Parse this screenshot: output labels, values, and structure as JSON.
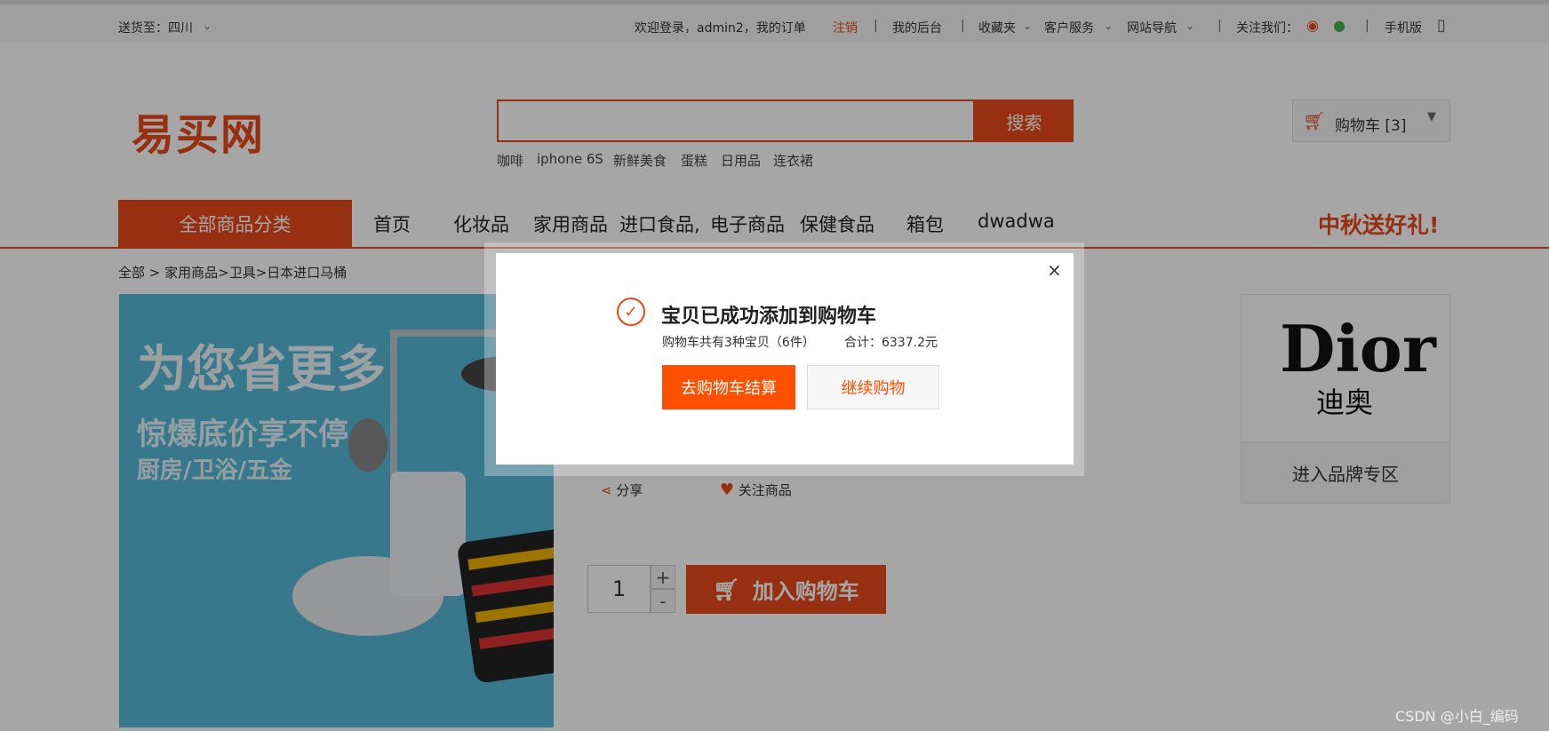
{
  "topbar": {
    "delivery": "送货至：四川",
    "welcome": "欢迎登录，admin2，我的订单",
    "logout": "注销",
    "backend": "我的后台",
    "favorites": "收藏夹",
    "service": "客户服务",
    "site_nav": "网站导航",
    "follow_us": "关注我们：",
    "mobile": "手机版"
  },
  "header": {
    "logo": "易买网",
    "search_placeholder": "",
    "search_button": "搜索",
    "hot_words": [
      "咖啡",
      "iphone 6S",
      "新鲜美食",
      "蛋糕",
      "日用品",
      "连衣裙"
    ],
    "cart_label": "购物车 [3]"
  },
  "nav": {
    "all_categories": "全部商品分类",
    "items": [
      "首页",
      "化妆品",
      "家用商品",
      "进口食品,",
      "电子商品",
      "保健食品",
      "箱包",
      "dwadwa"
    ],
    "promo": "中秋送好礼!"
  },
  "breadcrumb": {
    "root": "全部",
    "path": "家用商品>卫具>日本进口马桶"
  },
  "product": {
    "banner_line1": "为您省更多",
    "banner_line2": "惊爆底价享不停",
    "banner_line3": "厨房/卫浴/五金",
    "share": "分享",
    "follow": "关注商品",
    "quantity": "1",
    "plus": "+",
    "minus": "-",
    "add_to_cart": "加入购物车"
  },
  "brand": {
    "logo_text": "Dior",
    "logo_cn": "迪奥",
    "enter_label": "进入品牌专区"
  },
  "modal": {
    "close": "×",
    "title": "宝贝已成功添加到购物车",
    "summary": "购物车共有3种宝贝（6件）",
    "total": "合计：6337.2元",
    "checkout_button": "去购物车结算",
    "continue_button": "继续购物"
  },
  "watermark": "CSDN @小白_编码",
  "colors": {
    "accent": "#e8491b",
    "modal_button": "#ff5000"
  }
}
